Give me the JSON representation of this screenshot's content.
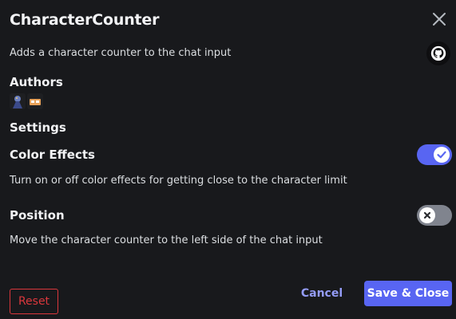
{
  "modal": {
    "title": "CharacterCounter",
    "description": "Adds a character counter to the chat input"
  },
  "icons": {
    "close": "close-icon",
    "github": "github-icon",
    "author_1": "author-avatar",
    "author_2": "author-avatar"
  },
  "authors": {
    "heading": "Authors"
  },
  "settings": {
    "heading": "Settings",
    "options": [
      {
        "title": "Color Effects",
        "description": "Turn on or off color effects for getting close to the character limit",
        "enabled": true
      },
      {
        "title": "Position",
        "description": "Move the character counter to the left side of the chat input",
        "enabled": false
      }
    ]
  },
  "footer": {
    "reset_label": "Reset",
    "cancel_label": "Cancel",
    "save_label": "Save & Close"
  },
  "colors": {
    "background": "#18191c",
    "accent": "#5865f2",
    "danger": "#da373c",
    "toggle_off": "#80848e"
  }
}
